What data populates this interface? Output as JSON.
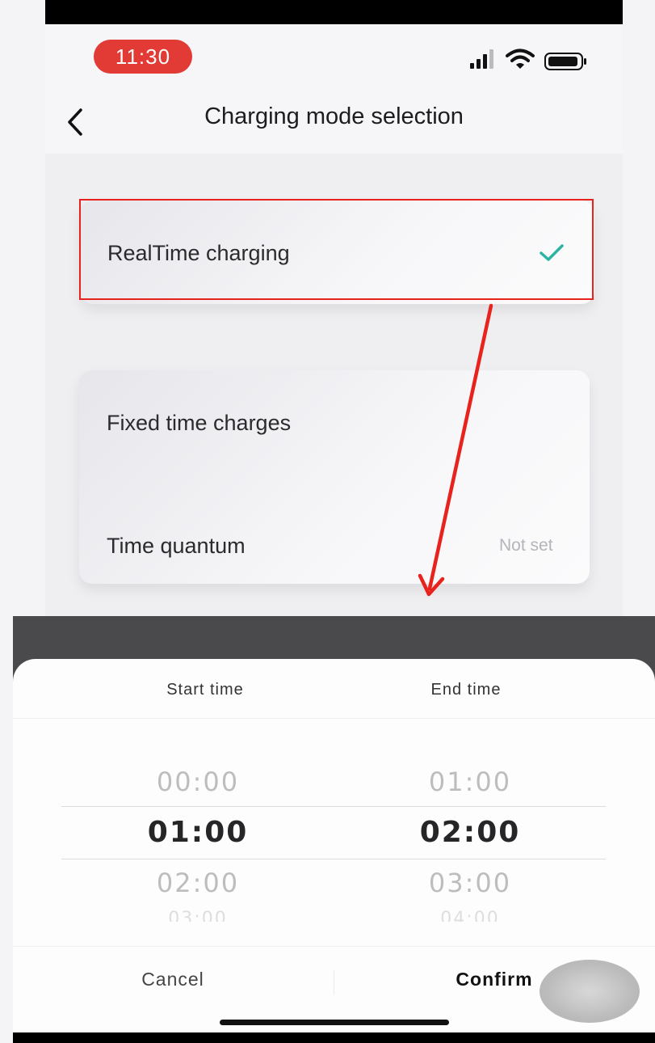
{
  "status_bar": {
    "time": "11:30"
  },
  "header": {
    "title": "Charging mode selection"
  },
  "options": {
    "realtime": {
      "label": "RealTime charging",
      "selected": true
    },
    "fixed": {
      "label": "Fixed time charges",
      "time_quantum_label": "Time quantum",
      "time_quantum_value": "Not set"
    }
  },
  "picker": {
    "start_head": "Start time",
    "end_head": "End time",
    "start": {
      "prev": "00:00",
      "selected": "01:00",
      "next": "02:00",
      "next2": "03:00"
    },
    "end": {
      "prev": "01:00",
      "selected": "02:00",
      "next": "03:00",
      "next2": "04:00"
    }
  },
  "actions": {
    "cancel": "Cancel",
    "confirm": "Confirm"
  },
  "colors": {
    "accent_check": "#2bb3a3",
    "time_pill": "#e23a34",
    "annotation": "#e8221d"
  }
}
